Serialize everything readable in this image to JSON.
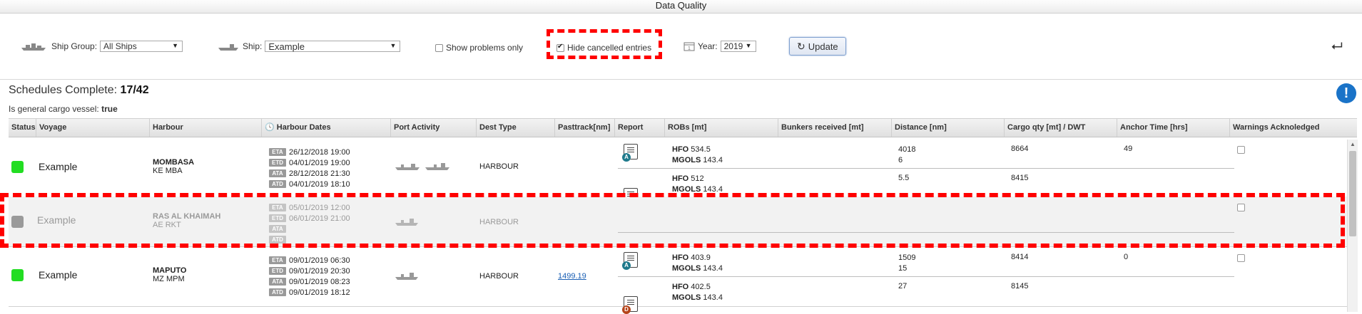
{
  "window": {
    "title": "Data Quality"
  },
  "toolbar": {
    "ship_group_label": "Ship Group:",
    "ship_group_value": "All Ships",
    "ship_label": "Ship:",
    "ship_value": "Example",
    "show_problems_label": "Show problems only",
    "show_problems_checked": false,
    "hide_cancelled_label": "Hide cancelled entries",
    "hide_cancelled_checked": true,
    "year_label": "Year:",
    "year_value": "2019",
    "update_label": "Update"
  },
  "summary": {
    "label": "Schedules Complete:",
    "value": "17/42",
    "cargo_label": "Is general cargo vessel:",
    "cargo_value": "true"
  },
  "table": {
    "columns": [
      "Status",
      "Voyage",
      "Harbour",
      "Harbour Dates",
      "Port Activity",
      "Dest Type",
      "Pasttrack[nm]",
      "Report",
      "ROBs [mt]",
      "Bunkers received [mt]",
      "Distance [nm]",
      "Cargo qty [mt] / DWT",
      "Anchor Time [hrs]",
      "Warnings Acknoledged"
    ],
    "rows": [
      {
        "status_color": "#22dd22",
        "voyage": "Example",
        "harbour_name": "MOMBASA",
        "harbour_code": "KE MBA",
        "dates": [
          {
            "tag": "ETA",
            "value": "26/12/2018 19:00"
          },
          {
            "tag": "ETD",
            "value": "04/01/2019 19:00"
          },
          {
            "tag": "ATA",
            "value": "28/12/2018 21:30"
          },
          {
            "tag": "ATD",
            "value": "04/01/2019 18:10"
          }
        ],
        "dest_type": "HARBOUR",
        "pasttrack": "",
        "reports": [
          {
            "badge": "A",
            "badge_color": "#1f7a8c",
            "hfo_label": "HFO",
            "hfo": "534.5",
            "mgo_label": "MGOLS",
            "mgo": "143.4",
            "distance1": "4018",
            "distance2": "6",
            "cargo": "8664",
            "anchor": "49"
          },
          {
            "badge": "D",
            "badge_color": "#b5441b",
            "hfo_label": "HFO",
            "hfo": "512",
            "mgo_label": "MGOLS",
            "mgo": "143.4",
            "distance1": "5.5",
            "distance2": "",
            "cargo": "8415",
            "anchor": ""
          }
        ]
      },
      {
        "status_color": "#9a9a9a",
        "voyage": "Example",
        "harbour_name": "RAS AL KHAIMAH",
        "harbour_code": "AE RKT",
        "dates": [
          {
            "tag": "ETA",
            "value": "05/01/2019 12:00"
          },
          {
            "tag": "ETD",
            "value": "06/01/2019 21:00"
          },
          {
            "tag": "ATA",
            "value": ""
          },
          {
            "tag": "ATD",
            "value": ""
          }
        ],
        "dest_type": "HARBOUR",
        "pasttrack": "",
        "reports": []
      },
      {
        "status_color": "#22dd22",
        "voyage": "Example",
        "harbour_name": "MAPUTO",
        "harbour_code": "MZ MPM",
        "dates": [
          {
            "tag": "ETA",
            "value": "09/01/2019 06:30"
          },
          {
            "tag": "ETD",
            "value": "09/01/2019 20:30"
          },
          {
            "tag": "ATA",
            "value": "09/01/2019 08:23"
          },
          {
            "tag": "ATD",
            "value": "09/01/2019 18:12"
          }
        ],
        "dest_type": "HARBOUR",
        "pasttrack": "1499.19",
        "reports": [
          {
            "badge": "A",
            "badge_color": "#1f7a8c",
            "hfo_label": "HFO",
            "hfo": "403.9",
            "mgo_label": "MGOLS",
            "mgo": "143.4",
            "distance1": "1509",
            "distance2": "15",
            "cargo": "8414",
            "anchor": "0"
          },
          {
            "badge": "D",
            "badge_color": "#b5441b",
            "hfo_label": "HFO",
            "hfo": "402.5",
            "mgo_label": "MGOLS",
            "mgo": "143.4",
            "distance1": "27",
            "distance2": "",
            "cargo": "8145",
            "anchor": ""
          }
        ]
      }
    ]
  }
}
